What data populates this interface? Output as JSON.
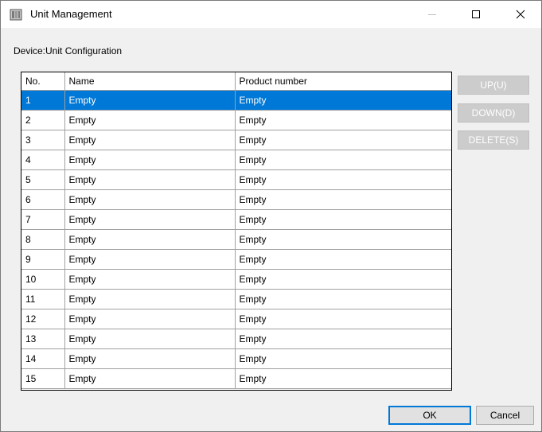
{
  "window": {
    "title": "Unit Management",
    "controls": {
      "minimize": "minimize-icon",
      "maximize": "maximize-icon",
      "close": "close-icon"
    }
  },
  "device_label": "Device:Unit Configuration",
  "table": {
    "headers": [
      "No.",
      "Name",
      "Product number"
    ],
    "selected_row": 0,
    "rows": [
      {
        "no": "1",
        "name": "Empty",
        "product": "Empty"
      },
      {
        "no": "2",
        "name": "Empty",
        "product": "Empty"
      },
      {
        "no": "3",
        "name": "Empty",
        "product": "Empty"
      },
      {
        "no": "4",
        "name": "Empty",
        "product": "Empty"
      },
      {
        "no": "5",
        "name": "Empty",
        "product": "Empty"
      },
      {
        "no": "6",
        "name": "Empty",
        "product": "Empty"
      },
      {
        "no": "7",
        "name": "Empty",
        "product": "Empty"
      },
      {
        "no": "8",
        "name": "Empty",
        "product": "Empty"
      },
      {
        "no": "9",
        "name": "Empty",
        "product": "Empty"
      },
      {
        "no": "10",
        "name": "Empty",
        "product": "Empty"
      },
      {
        "no": "11",
        "name": "Empty",
        "product": "Empty"
      },
      {
        "no": "12",
        "name": "Empty",
        "product": "Empty"
      },
      {
        "no": "13",
        "name": "Empty",
        "product": "Empty"
      },
      {
        "no": "14",
        "name": "Empty",
        "product": "Empty"
      },
      {
        "no": "15",
        "name": "Empty",
        "product": "Empty"
      }
    ]
  },
  "side_buttons": {
    "up": "UP(U)",
    "down": "DOWN(D)",
    "delete": "DELETE(S)"
  },
  "bottom_buttons": {
    "ok": "OK",
    "cancel": "Cancel"
  },
  "colors": {
    "selection": "#0078d7",
    "disabled_button": "#cccccc"
  }
}
